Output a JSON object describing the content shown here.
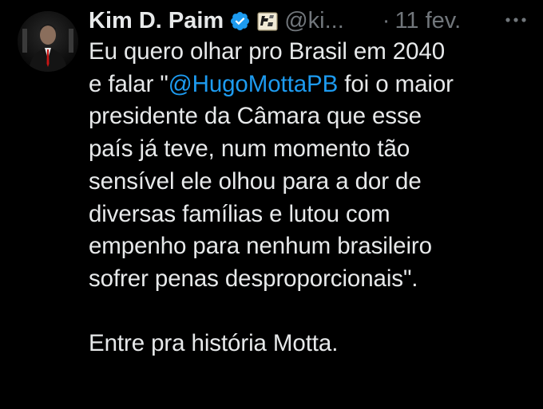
{
  "author": {
    "name": "Kim D. Paim",
    "handle": "@ki...",
    "separator": "·",
    "date": "11 fev."
  },
  "icons": {
    "verified": "verified-badge-icon",
    "affiliate": "affiliate-badge-icon",
    "more": "more-options-icon"
  },
  "colors": {
    "background": "#000000",
    "text": "#e7e9ea",
    "muted": "#71767b",
    "link": "#1d9bf0",
    "verified": "#1d9bf0"
  },
  "tweet": {
    "line1": "Eu quero olhar pro Brasil em 2040",
    "line2_before": "e falar \"",
    "mention": "@HugoMottaPB",
    "line2_after": " foi o maior",
    "line3": "presidente da Câmara que esse",
    "line4": "país já teve, num momento tão",
    "line5": "sensível ele olhou para a dor de",
    "line6": "diversas famílias e lutou com",
    "line7": "empenho para nenhum brasileiro",
    "line8": "sofrer penas desproporcionais\".",
    "line9": "Entre pra história Motta."
  }
}
